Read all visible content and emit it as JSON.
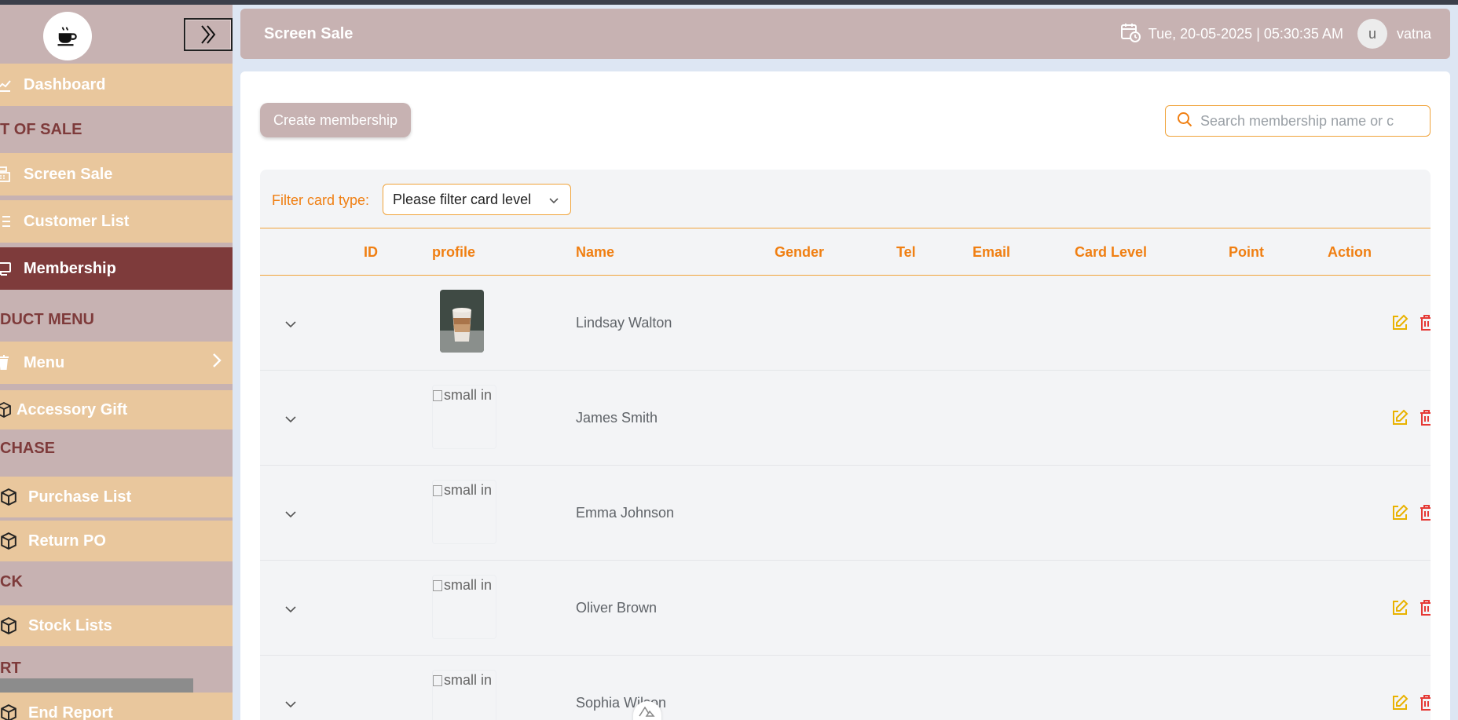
{
  "sidebar": {
    "nav": [
      {
        "label": "Dashboard",
        "icon": "chart-line-icon"
      },
      {
        "label": "Screen Sale",
        "icon": "cash-register-icon"
      },
      {
        "label": "Customer List",
        "icon": "list-icon"
      },
      {
        "label": "Membership",
        "icon": "id-card-icon"
      },
      {
        "label": "Menu",
        "icon": "cup-icon"
      },
      {
        "label": "Accessory Gift",
        "icon": "box-icon"
      },
      {
        "label": "Purchase List",
        "icon": "box-icon"
      },
      {
        "label": "Return PO",
        "icon": "box-icon"
      },
      {
        "label": "Stock Lists",
        "icon": "box-icon"
      },
      {
        "label": "End Report",
        "icon": "box-icon"
      }
    ],
    "sections": [
      "T OF SALE",
      "DUCT MENU",
      "CHASE",
      "CK",
      "RT"
    ]
  },
  "header": {
    "title": "Screen Sale",
    "datetime": "Tue, 20-05-2025 | 05:30:35 AM",
    "avatar_letter": "u",
    "username": "vatna"
  },
  "toolbar": {
    "create_label": "Create membership",
    "search_placeholder": "Search membership name or c"
  },
  "filter": {
    "label": "Filter card type:",
    "selected": "Please filter card level"
  },
  "table": {
    "columns": [
      "ID",
      "profile",
      "Name",
      "Gender",
      "Tel",
      "Email",
      "Card Level",
      "Point",
      "Action"
    ],
    "rows": [
      {
        "name": "Lindsay Walton",
        "profile": "photo",
        "alt": ""
      },
      {
        "name": "James Smith",
        "profile": "broken",
        "alt": "small in"
      },
      {
        "name": "Emma Johnson",
        "profile": "broken",
        "alt": "small in"
      },
      {
        "name": "Oliver Brown",
        "profile": "broken",
        "alt": "small in"
      },
      {
        "name": "Sophia Wilson",
        "profile": "broken",
        "alt": "small in"
      }
    ]
  },
  "colors": {
    "sidebar_bg": "#c7b2b2",
    "nav_item_bg": "#e9c79d",
    "nav_active_bg": "#7e3b3b",
    "accent_orange": "#f07f12",
    "edit_yellow": "#e9b200",
    "delete_red": "#e53935"
  }
}
